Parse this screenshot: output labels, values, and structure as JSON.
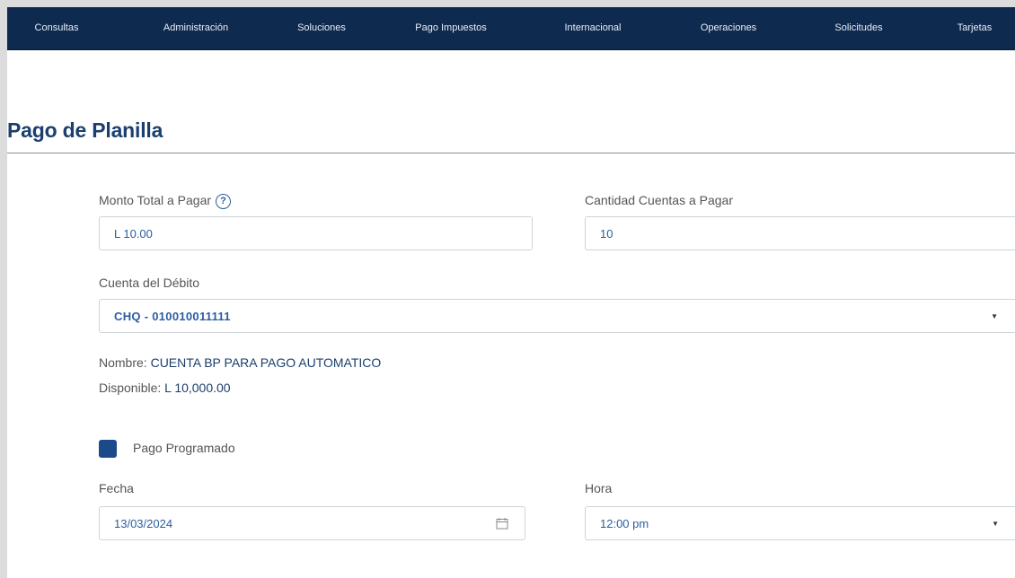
{
  "nav": {
    "items": [
      "Consultas",
      "Administración",
      "Soluciones",
      "Pago Impuestos",
      "Internacional",
      "Operaciones",
      "Solicitudes",
      "Tarjetas"
    ]
  },
  "page": {
    "title": "Pago de Planilla"
  },
  "form": {
    "monto_label": "Monto Total a Pagar",
    "monto_value": "L 10.00",
    "cantidad_label": "Cantidad Cuentas a Pagar",
    "cantidad_value": "10",
    "cuenta_label": "Cuenta del Débito",
    "cuenta_value": "CHQ - 010010011111",
    "nombre_label": "Nombre:",
    "nombre_value": "CUENTA BP PARA PAGO AUTOMATICO",
    "disponible_label": "Disponible:",
    "disponible_value": "L 10,000.00",
    "programado_label": "Pago Programado",
    "programado_checked": true,
    "fecha_label": "Fecha",
    "fecha_value": "13/03/2024",
    "hora_label": "Hora",
    "hora_value": "12:00 pm"
  },
  "icons": {
    "help": "help-circle-icon",
    "dropdown": "chevron-down-icon",
    "calendar": "calendar-icon"
  },
  "colors": {
    "nav_bg": "#0f2a4f",
    "accent": "#1b3f6e",
    "value_text": "#2a5da0",
    "checkbox": "#1b4a8a"
  }
}
